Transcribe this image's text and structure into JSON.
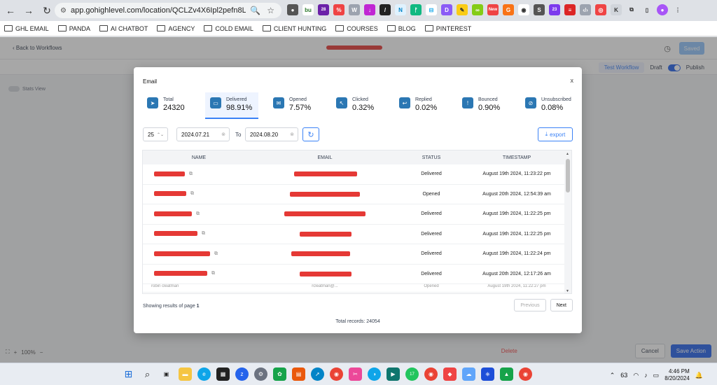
{
  "browser": {
    "url": "app.gohighlevel.com/location/QCLZv4X6Ipl2pefn8LvM/wo...",
    "bookmarks": [
      "GHL EMAIL",
      "PANDA",
      "AI CHATBOT",
      "AGENCY",
      "COLD EMAIL",
      "CLIENT HUNTING",
      "COURSES",
      "BLOG",
      "PINTEREST"
    ],
    "extension_badges": {
      "a": "28",
      "b": "23",
      "new": "New"
    }
  },
  "app": {
    "back": "Back to Workflows",
    "saved": "Saved",
    "test_workflow": "Test Workflow",
    "draft": "Draft",
    "publish": "Publish",
    "stats_view": "Stats View",
    "zoom": "100%",
    "delete": "Delete",
    "cancel": "Cancel",
    "save_action": "Save Action"
  },
  "modal": {
    "title": "Email",
    "close": "x",
    "cards": [
      {
        "label": "Total",
        "value": "24320",
        "icon": "send-icon"
      },
      {
        "label": "Delivered",
        "value": "98.91%",
        "icon": "inbox-icon"
      },
      {
        "label": "Opened",
        "value": "7.57%",
        "icon": "envelope-open-icon"
      },
      {
        "label": "Clicked",
        "value": "0.32%",
        "icon": "cursor-icon"
      },
      {
        "label": "Replied",
        "value": "0.02%",
        "icon": "reply-icon"
      },
      {
        "label": "Bounced",
        "value": "0.90%",
        "icon": "alert-icon"
      },
      {
        "label": "Unsubscribed",
        "value": "0.08%",
        "icon": "unsubscribe-icon"
      }
    ],
    "page_size": "25",
    "date_from": "2024.07.21",
    "to_label": "To",
    "date_to": "2024.08.20",
    "export": "export",
    "columns": [
      "NAME",
      "EMAIL",
      "STATUS",
      "TIMESTAMP"
    ],
    "rows": [
      {
        "status": "Delivered",
        "timestamp": "August 19th 2024, 11:23:22 pm"
      },
      {
        "status": "Opened",
        "timestamp": "August 20th 2024, 12:54:39 am"
      },
      {
        "status": "Delivered",
        "timestamp": "August 19th 2024, 11:22:25 pm"
      },
      {
        "status": "Delivered",
        "timestamp": "August 19th 2024, 11:22:25 pm"
      },
      {
        "status": "Delivered",
        "timestamp": "August 19th 2024, 11:22:24 pm"
      },
      {
        "status": "Delivered",
        "timestamp": "August 20th 2024, 12:17:26 am"
      }
    ],
    "partial_row": {
      "name": "robin cleatman",
      "email": "rcleatman@...",
      "status": "Opened",
      "timestamp": "August 19th 2024, 11:22:27 pm"
    },
    "showing_prefix": "Showing results of page",
    "page_number": "1",
    "previous": "Previous",
    "next": "Next",
    "total_records_label": "Total records:",
    "total_records": "24054"
  },
  "taskbar": {
    "whatsapp_badge": "17",
    "temperature": "63",
    "time": "4:46 PM",
    "date": "8/20/2024"
  }
}
